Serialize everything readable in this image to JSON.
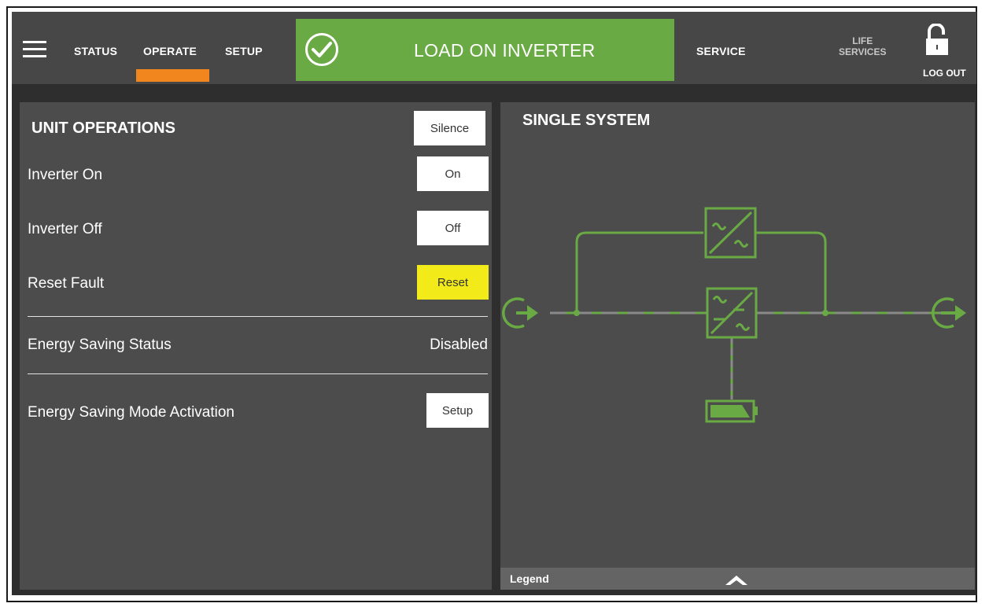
{
  "colors": {
    "status_ok": "#6aaa45",
    "tab_indicator": "#f0861d",
    "reset_button": "#f2ea19",
    "diagram_line": "#6aaa45",
    "panel_bg": "#4c4c4c",
    "topbar_bg": "#474747"
  },
  "nav": {
    "menu_icon": "hamburger-icon",
    "tabs": [
      "STATUS",
      "OPERATE",
      "SETUP"
    ],
    "active_tab": "OPERATE",
    "service": "SERVICE",
    "life_services_line1": "LIFE",
    "life_services_line2": "SERVICES",
    "logout": "LOG OUT",
    "lock_icon": "unlocked-padlock-icon"
  },
  "status": {
    "icon": "checkmark-circle-icon",
    "text": "LOAD ON INVERTER"
  },
  "unit_operations": {
    "title": "UNIT OPERATIONS",
    "silence_button": "Silence",
    "rows": [
      {
        "label": "Inverter On",
        "button": "On"
      },
      {
        "label": "Inverter Off",
        "button": "Off"
      },
      {
        "label": "Reset Fault",
        "button": "Reset"
      }
    ],
    "energy_saving_status_label": "Energy Saving Status",
    "energy_saving_status_value": "Disabled",
    "energy_saving_mode_label": "Energy Saving Mode Activation",
    "energy_saving_mode_button": "Setup"
  },
  "single_system": {
    "title": "SINGLE SYSTEM",
    "icons": [
      "input-icon",
      "bypass-converter-icon",
      "rectifier-inverter-icon",
      "battery-icon",
      "output-icon"
    ],
    "legend_label": "Legend",
    "legend_icon": "chevron-up-icon"
  }
}
